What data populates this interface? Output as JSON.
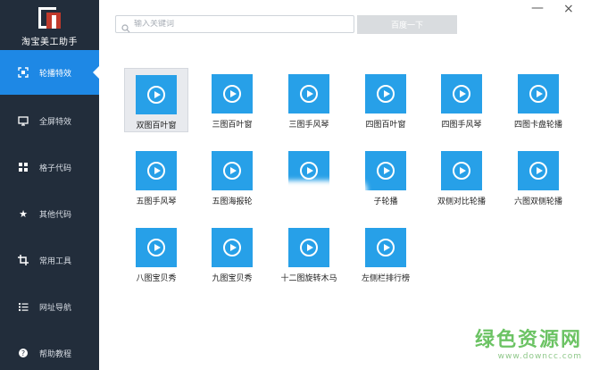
{
  "app": {
    "title": "淘宝美工助手"
  },
  "search": {
    "placeholder": "输入关键词",
    "button_label": "百度一下"
  },
  "window": {
    "minimize": "—",
    "close": "×"
  },
  "sidebar": {
    "items": [
      {
        "label": "轮播特效",
        "icon": "carousel-icon",
        "active": true
      },
      {
        "label": "全屏特效",
        "icon": "monitor-icon",
        "active": false
      },
      {
        "label": "格子代码",
        "icon": "grid-icon",
        "active": false
      },
      {
        "label": "其他代码",
        "icon": "star-icon",
        "active": false
      },
      {
        "label": "常用工具",
        "icon": "crop-icon",
        "active": false
      },
      {
        "label": "网址导航",
        "icon": "list-icon",
        "active": false
      },
      {
        "label": "帮助教程",
        "icon": "help-icon",
        "active": false
      }
    ]
  },
  "tiles": [
    {
      "label": "双图百叶窗",
      "icon": "play-icon"
    },
    {
      "label": "三图百叶窗",
      "icon": "play-icon"
    },
    {
      "label": "三图手风琴",
      "icon": "play-icon"
    },
    {
      "label": "四图百叶窗",
      "icon": "play-icon"
    },
    {
      "label": "四图手风琴",
      "icon": "play-icon"
    },
    {
      "label": "四图卡盘轮播",
      "icon": "play-icon"
    },
    {
      "label": "五图手风琴",
      "icon": "play-icon"
    },
    {
      "label": "五图海报轮",
      "icon": "play-icon"
    },
    {
      "label": "",
      "icon": "play-icon"
    },
    {
      "label": "子轮播",
      "icon": "play-icon"
    },
    {
      "label": "双侧对比轮播",
      "icon": "play-icon"
    },
    {
      "label": "六图双侧轮播",
      "icon": "play-icon"
    },
    {
      "label": "八图宝贝秀",
      "icon": "play-icon"
    },
    {
      "label": "九图宝贝秀",
      "icon": "play-icon"
    },
    {
      "label": "十二图旋转木马",
      "icon": "play-icon"
    },
    {
      "label": "左侧栏排行榜",
      "icon": "play-icon"
    }
  ],
  "selected_tile": 0,
  "watermark": {
    "text": "绿色资源网",
    "url": "www.downcc.com"
  },
  "colors": {
    "sidebar_bg": "#222d3b",
    "accent": "#1e88e5",
    "thumb": "#27a0e8",
    "watermark": "#53b94a"
  }
}
